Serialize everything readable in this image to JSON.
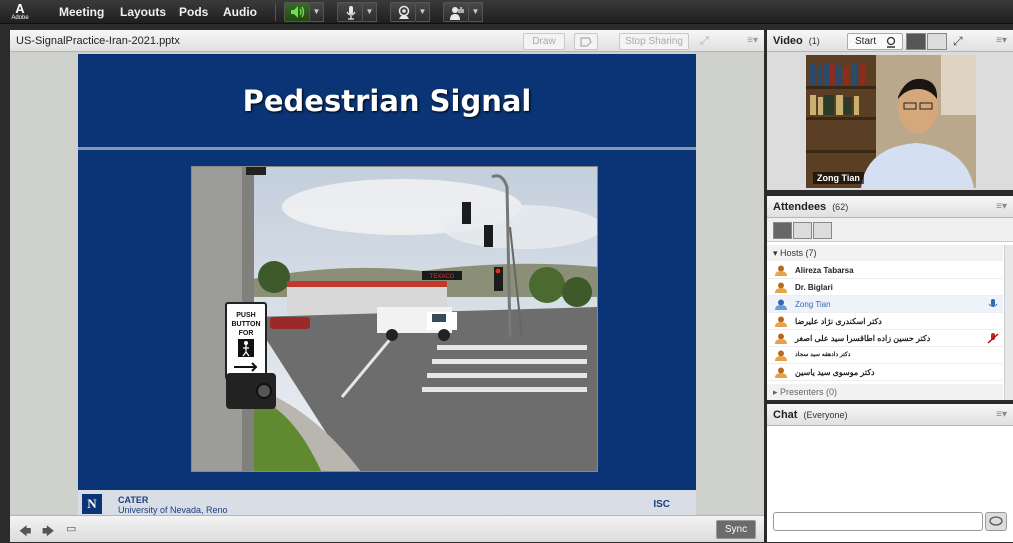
{
  "app": {
    "logo_text": "Adobe"
  },
  "menu": {
    "items": [
      "Meeting",
      "Layouts",
      "Pods",
      "Audio"
    ]
  },
  "share_pod": {
    "file_name": "US-SignalPractice-Iran-2021.pptx",
    "draw_label": "Draw",
    "stop_sharing_label": "Stop Sharing",
    "sync_label": "Sync",
    "slide": {
      "title": "Pedestrian Signal",
      "footer_org": "CATER",
      "footer_university": "University of Nevada, Reno",
      "footer_right": "ISC",
      "photo_sign_lines": [
        "PUSH",
        "BUTTON",
        "FOR"
      ],
      "photo_store_text": "TEXACO"
    }
  },
  "video_pod": {
    "title": "Video",
    "count": "(1)",
    "start_label": "Start",
    "presenter_name": "Zong Tian"
  },
  "attendees_pod": {
    "title": "Attendees",
    "count": "(62)",
    "hosts_label": "Hosts (7)",
    "hosts": [
      {
        "name": "Alireza Tabarsa",
        "highlight": false
      },
      {
        "name": "Dr. Biglari",
        "highlight": false
      },
      {
        "name": "Zong Tian",
        "highlight": true
      },
      {
        "name": "دکتر اسکندری نژاد علیرضا",
        "highlight": false
      },
      {
        "name": "دکتر حسین زاده اطاقسرا سید علی اصغر",
        "highlight": false
      },
      {
        "name": "دکتر دادهقه سید سجاد",
        "highlight": false
      },
      {
        "name": "دکتر موسوی سید یاسین",
        "highlight": false
      }
    ],
    "presenters_label": "Presenters (0)"
  },
  "chat_pod": {
    "title": "Chat",
    "scope": "(Everyone)"
  },
  "colors": {
    "slide_bg": "#0a3476",
    "active_audio": "#3a6a2a",
    "host_link": "#3467b4"
  }
}
